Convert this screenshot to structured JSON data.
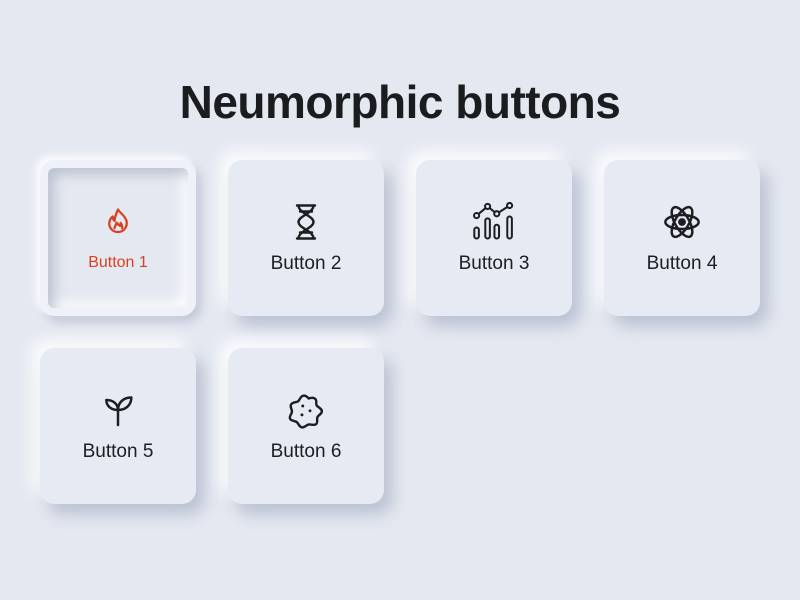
{
  "title": "Neumorphic buttons",
  "accent_color": "#d9401f",
  "buttons": [
    {
      "label": "Button 1",
      "icon": "flame-icon",
      "active": true
    },
    {
      "label": "Button 2",
      "icon": "dna-icon",
      "active": false
    },
    {
      "label": "Button 3",
      "icon": "chart-icon",
      "active": false
    },
    {
      "label": "Button 4",
      "icon": "atom-icon",
      "active": false
    },
    {
      "label": "Button 5",
      "icon": "sprout-icon",
      "active": false
    },
    {
      "label": "Button 6",
      "icon": "cookie-icon",
      "active": false
    }
  ]
}
